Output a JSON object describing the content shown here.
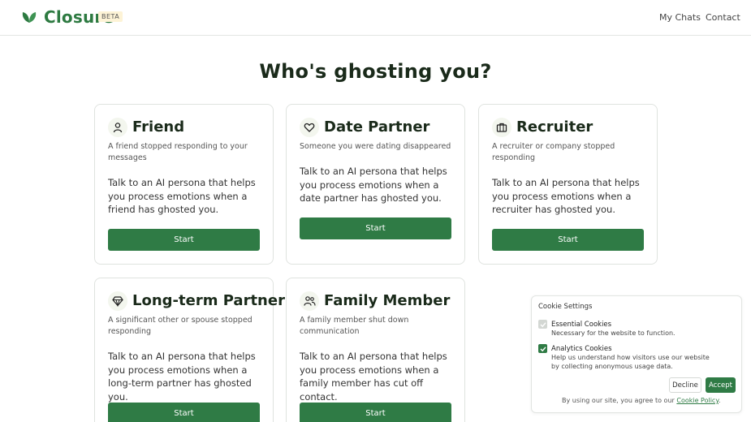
{
  "header": {
    "brand": "Closure",
    "badge": "BETA",
    "nav": {
      "chats": "My Chats",
      "contact": "Contact"
    },
    "brand_color": "#2d7a41"
  },
  "main": {
    "title": "Who's ghosting you?",
    "cards": [
      {
        "title": "Friend",
        "icon": "person-icon",
        "subtitle": "A friend stopped responding to your messages",
        "body": "Talk to an AI persona that helps you process emotions when a friend has ghosted you.",
        "button": "Start"
      },
      {
        "title": "Date Partner",
        "icon": "heart-icon",
        "subtitle": "Someone you were dating disappeared",
        "body": "Talk to an AI persona that helps you process emotions when a date partner has ghosted you.",
        "button": "Start"
      },
      {
        "title": "Recruiter",
        "icon": "briefcase-icon",
        "subtitle": "A recruiter or company stopped responding",
        "body": "Talk to an AI persona that helps you process emotions when a recruiter has ghosted you.",
        "button": "Start"
      },
      {
        "title": "Long-term Partner",
        "icon": "diamond-icon",
        "subtitle": "A significant other or spouse stopped responding",
        "body": "Talk to an AI persona that helps you process emotions when a long-term partner has ghosted you.",
        "button": "Start"
      },
      {
        "title": "Family Member",
        "icon": "family-icon",
        "subtitle": "A family member shut down communication",
        "body": "Talk to an AI persona that helps you process emotions when a family member has cut off contact.",
        "button": "Start"
      }
    ],
    "accent_color": "#2f7b45"
  },
  "cookie": {
    "title": "Cookie Settings",
    "essential": {
      "title": "Essential Cookies",
      "desc": "Necessary for the website to function.",
      "checked": true
    },
    "analytics": {
      "title": "Analytics Cookies",
      "desc": "Help us understand how visitors use our website by collecting anonymous usage data.",
      "checked": true
    },
    "decline": "Decline",
    "accept": "Accept",
    "footer_text": "By using our site, you agree to our",
    "policy_link": "Cookie Policy",
    "footer_end": "."
  }
}
